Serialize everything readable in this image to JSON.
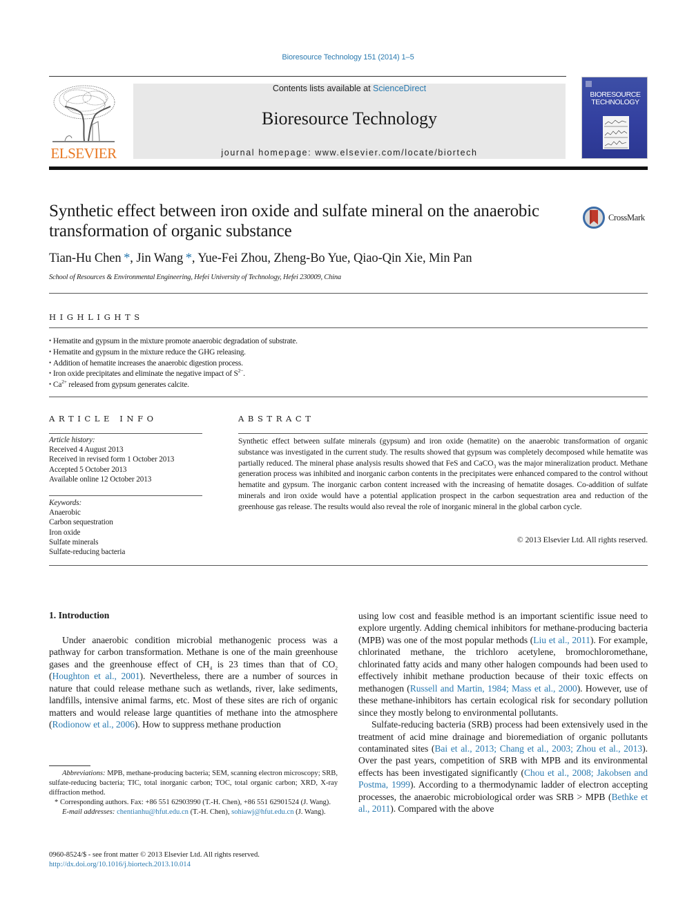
{
  "journal_ref": "Bioresource Technology 151 (2014) 1–5",
  "banner": {
    "contents_prefix": "Contents lists available at ",
    "contents_link": "ScienceDirect",
    "journal_title": "Bioresource Technology",
    "homepage": "journal homepage: www.elsevier.com/locate/biortech"
  },
  "publisher_logo": "ELSEVIER",
  "cover": {
    "title_line1": "BIORESOURCE",
    "title_line2": "TECHNOLOGY"
  },
  "crossmark": "CrossMark",
  "article": {
    "title": "Synthetic effect between iron oxide and sulfate mineral on the anaerobic transformation of organic substance",
    "authors": [
      {
        "name": "Tian-Hu Chen",
        "corresponding": true
      },
      {
        "name": "Jin Wang",
        "corresponding": true
      },
      {
        "name": "Yue-Fei Zhou",
        "corresponding": false
      },
      {
        "name": "Zheng-Bo Yue",
        "corresponding": false
      },
      {
        "name": "Qiao-Qin Xie",
        "corresponding": false
      },
      {
        "name": "Min Pan",
        "corresponding": false
      }
    ],
    "affiliation": "School of Resources & Environmental Engineering, Hefei University of Technology, Hefei 230009, China"
  },
  "highlights": {
    "heading": "HIGHLIGHTS",
    "items": [
      {
        "text": "Hematite and gypsum in the mixture promote anaerobic degradation of substrate."
      },
      {
        "text": "Hematite and gypsum in the mixture reduce the GHG releasing."
      },
      {
        "text": "Addition of hematite increases the anaerobic digestion process."
      },
      {
        "text": "Iron oxide precipitates and eliminate the negative impact of S",
        "sup": "2−",
        "after": "."
      },
      {
        "text": "Ca",
        "sup": "2+",
        "after": " released from gypsum generates calcite."
      }
    ]
  },
  "article_info": {
    "heading": "ARTICLE INFO",
    "history_label": "Article history:",
    "history": [
      "Received 4 August 2013",
      "Received in revised form 1 October 2013",
      "Accepted 5 October 2013",
      "Available online 12 October 2013"
    ],
    "keywords_label": "Keywords:",
    "keywords": [
      "Anaerobic",
      "Carbon sequestration",
      "Iron oxide",
      "Sulfate minerals",
      "Sulfate-reducing bacteria"
    ]
  },
  "abstract": {
    "heading": "ABSTRACT",
    "part1": "Synthetic effect between sulfate minerals (gypsum) and iron oxide (hematite) on the anaerobic transformation of organic substance was investigated in the current study. The results showed that gypsum was completely decomposed while hematite was partially reduced. The mineral phase analysis results showed that FeS and CaCO",
    "sub1": "3",
    "part2": " was the major mineralization product. Methane generation process was inhibited and inorganic carbon contents in the precipitates were enhanced compared to the control without hematite and gypsum. The inorganic carbon content increased with the increasing of hematite dosages. Co-addition of sulfate minerals and iron oxide would have a potential application prospect in the carbon sequestration area and reduction of the greenhouse gas release. The results would also reveal the role of inorganic mineral in the global carbon cycle.",
    "copyright": "© 2013 Elsevier Ltd. All rights reserved."
  },
  "introduction": {
    "heading": "1. Introduction",
    "col1": {
      "t1": "Under anaerobic condition microbial methanogenic process was a pathway for carbon transformation. Methane is one of the main greenhouse gases and the greenhouse effect of CH",
      "sub1": "4",
      "t2": " is 23 times than that of CO",
      "sub2": "2",
      "t3": " (",
      "ref1": "Houghton et al., 2001",
      "t4": "). Nevertheless, there are a number of sources in nature that could release methane such as wetlands, river, lake sediments, landfills, intensive animal farms, etc. Most of these sites are rich of organic matters and would release large quantities of methane into the atmosphere (",
      "ref2": "Rodionow et al., 2006",
      "t5": "). How to suppress methane production"
    },
    "col2_p1": {
      "t1": "using low cost and feasible method is an important scientific issue need to explore urgently. Adding chemical inhibitors for methane-producing bacteria (MPB) was one of the most popular methods (",
      "ref1": "Liu et al., 2011",
      "t2": "). For example, chlorinated methane, the trichloro acetylene, bromochloromethane, chlorinated fatty acids and many other halogen compounds had been used to effectively inhibit methane production because of their toxic effects on methanogen (",
      "ref2": "Russell and Martin, 1984; Mass et al., 2000",
      "t3": "). However, use of these methane-inhibitors has certain ecological risk for secondary pollution since they mostly belong to environmental pollutants."
    },
    "col2_p2": {
      "t1": "Sulfate-reducing bacteria (SRB) process had been extensively used in the treatment of acid mine drainage and bioremediation of organic pollutants contaminated sites (",
      "ref1": "Bai et al., 2013; Chang et al., 2003; Zhou et al., 2013",
      "t2": "). Over the past years, competition of SRB with MPB and its environmental effects has been investigated significantly (",
      "ref2": "Chou et al., 2008; Jakobsen and Postma, 1999",
      "t3": "). According to a thermodynamic ladder of electron accepting processes, the anaerobic microbiological order was SRB > MPB (",
      "ref3": "Bethke et al., 2011",
      "t4": "). Compared with the above"
    }
  },
  "footnotes": {
    "abbr_label": "Abbreviations:",
    "abbr_text": " MPB, methane-producing bacteria; SEM, scanning electron microscopy; SRB, sulfate-reducing bacteria; TIC, total inorganic carbon; TOC, total organic carbon; XRD, X-ray diffraction method.",
    "corr_mark": "*",
    "corr_text": " Corresponding authors. Fax: +86 551 62903990 (T.-H. Chen), +86 551 62901524 (J. Wang).",
    "email_label": "E-mail addresses:",
    "email1": "chentianhu@hfut.edu.cn",
    "email1_after": " (T.-H. Chen), ",
    "email2": "sohiawj@hfut.edu.cn",
    "email2_after": " (J. Wang)."
  },
  "bottom": {
    "issn": "0960-8524/$ - see front matter © 2013 Elsevier Ltd. All rights reserved.",
    "doi": "http://dx.doi.org/10.1016/j.biortech.2013.10.014"
  },
  "colors": {
    "link": "#2a7ab0",
    "elsevier_orange": "#e87722",
    "banner_bg": "#e8e8e8",
    "cover_blue": "#3d4fa6"
  }
}
